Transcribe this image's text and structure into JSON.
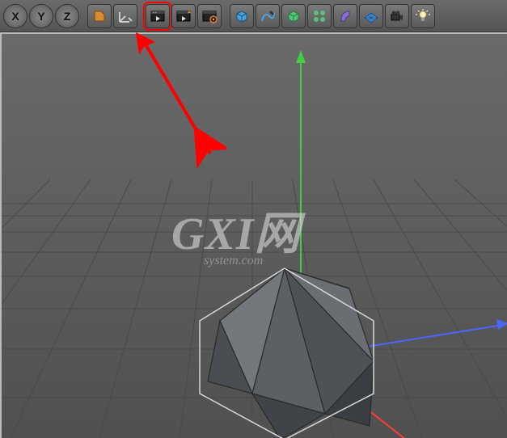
{
  "toolbar": {
    "axis_x": "X",
    "axis_y": "Y",
    "axis_z": "Z",
    "buttons": [
      {
        "name": "make-editable-icon",
        "color": "#d98a2e"
      },
      {
        "name": "enable-axis-icon",
        "color": "#c0c0c0"
      },
      {
        "name": "render-view-icon",
        "color": "#222",
        "selected": true
      },
      {
        "name": "render-picture-viewer-icon",
        "color": "#222"
      },
      {
        "name": "render-settings-icon",
        "color": "#222"
      },
      {
        "name": "cube-primitive-icon",
        "color": "#4aa3df"
      },
      {
        "name": "spline-pen-icon",
        "color": "#4aa3df"
      },
      {
        "name": "subdivision-surface-icon",
        "color": "#59c27a"
      },
      {
        "name": "array-icon",
        "color": "#59c27a"
      },
      {
        "name": "bend-deformer-icon",
        "color": "#8a6fd1"
      },
      {
        "name": "floor-icon",
        "color": "#4a90d9"
      },
      {
        "name": "camera-icon",
        "color": "#333"
      },
      {
        "name": "light-icon",
        "color": "#f5f0c0"
      }
    ]
  },
  "watermark": {
    "line1": "GXI网",
    "line2": "system.com"
  },
  "scene": {
    "object": "icosahedron",
    "axes": [
      "x-red",
      "y-green",
      "z-blue"
    ]
  },
  "annotation": {
    "type": "red-arrow",
    "target": "render-view-icon"
  }
}
